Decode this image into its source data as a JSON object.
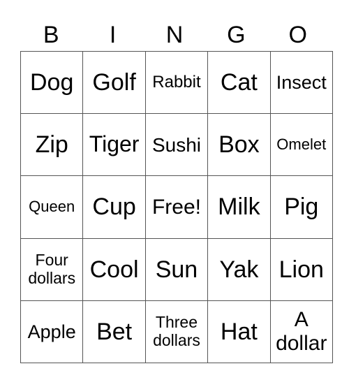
{
  "header": [
    "B",
    "I",
    "N",
    "G",
    "O"
  ],
  "rows": [
    [
      {
        "text": "Dog",
        "size": 34
      },
      {
        "text": "Golf",
        "size": 34
      },
      {
        "text": "Rabbit",
        "size": 24
      },
      {
        "text": "Cat",
        "size": 34
      },
      {
        "text": "Insect",
        "size": 27
      }
    ],
    [
      {
        "text": "Zip",
        "size": 34
      },
      {
        "text": "Tiger",
        "size": 32
      },
      {
        "text": "Sushi",
        "size": 28
      },
      {
        "text": "Box",
        "size": 34
      },
      {
        "text": "Omelet",
        "size": 22
      }
    ],
    [
      {
        "text": "Queen",
        "size": 22
      },
      {
        "text": "Cup",
        "size": 34
      },
      {
        "text": "Free!",
        "size": 30
      },
      {
        "text": "Milk",
        "size": 34
      },
      {
        "text": "Pig",
        "size": 34
      }
    ],
    [
      {
        "text": "Four dollars",
        "size": 23
      },
      {
        "text": "Cool",
        "size": 34
      },
      {
        "text": "Sun",
        "size": 34
      },
      {
        "text": "Yak",
        "size": 34
      },
      {
        "text": "Lion",
        "size": 34
      }
    ],
    [
      {
        "text": "Apple",
        "size": 27
      },
      {
        "text": "Bet",
        "size": 34
      },
      {
        "text": "Three dollars",
        "size": 23
      },
      {
        "text": "Hat",
        "size": 34
      },
      {
        "text": "A dollar",
        "size": 30
      }
    ]
  ]
}
